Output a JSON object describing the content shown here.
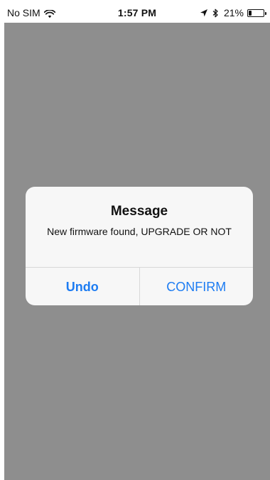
{
  "status_bar": {
    "carrier": "No SIM",
    "time": "1:57 PM",
    "battery_percent": "21%",
    "battery_level": 0.21,
    "icons": [
      "wifi-icon",
      "location-icon",
      "bluetooth-icon",
      "battery-icon"
    ]
  },
  "alert": {
    "title": "Message",
    "message": "New firmware found, UPGRADE OR NOT",
    "buttons": {
      "undo": "Undo",
      "confirm": "CONFIRM"
    }
  },
  "colors": {
    "overlay": "#8e8e8e",
    "button_text": "#1d7cf2",
    "alert_background": "#f7f7f7"
  }
}
